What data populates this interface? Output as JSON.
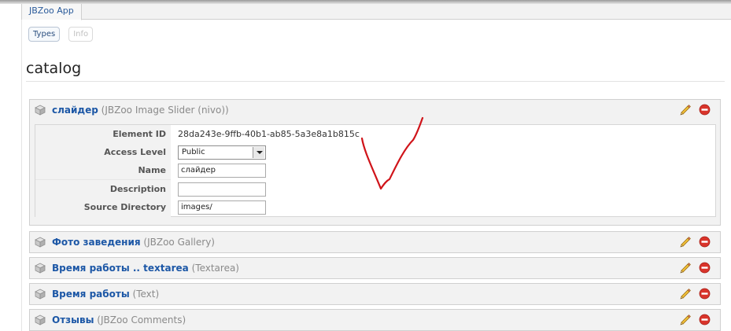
{
  "app_tab": "JBZoo App",
  "subtabs": [
    {
      "label": "Types",
      "active": true
    },
    {
      "label": "Info",
      "active": false
    }
  ],
  "page_title": "catalog",
  "elements": [
    {
      "name": "слайдер",
      "type": "(JBZoo Image Slider (nivo))",
      "expanded": true,
      "properties": {
        "element_id": {
          "label": "Element ID",
          "value": "28da243e-9ffb-40b1-ab85-5a3e8a1b815c"
        },
        "access_level": {
          "label": "Access Level",
          "value": "Public"
        },
        "name": {
          "label": "Name",
          "value": "слайдер"
        },
        "description": {
          "label": "Description",
          "value": ""
        },
        "source_directory": {
          "label": "Source Directory",
          "value": "images/"
        }
      }
    },
    {
      "name": "Фото заведения",
      "type": "(JBZoo Gallery)",
      "expanded": false
    },
    {
      "name": "Время работы .. textarea",
      "type": "(Textarea)",
      "expanded": false
    },
    {
      "name": "Время работы",
      "type": "(Text)",
      "expanded": false
    },
    {
      "name": "Отзывы",
      "type": "(JBZoo Comments)",
      "expanded": false
    }
  ],
  "icons": {
    "element": "cube-icon",
    "edit": "pencil-icon",
    "delete": "delete-icon",
    "dropdown": "chevron-down-icon"
  },
  "colors": {
    "link": "#1c57a6",
    "delete": "#d9342b",
    "annotation": "#d0141a"
  }
}
